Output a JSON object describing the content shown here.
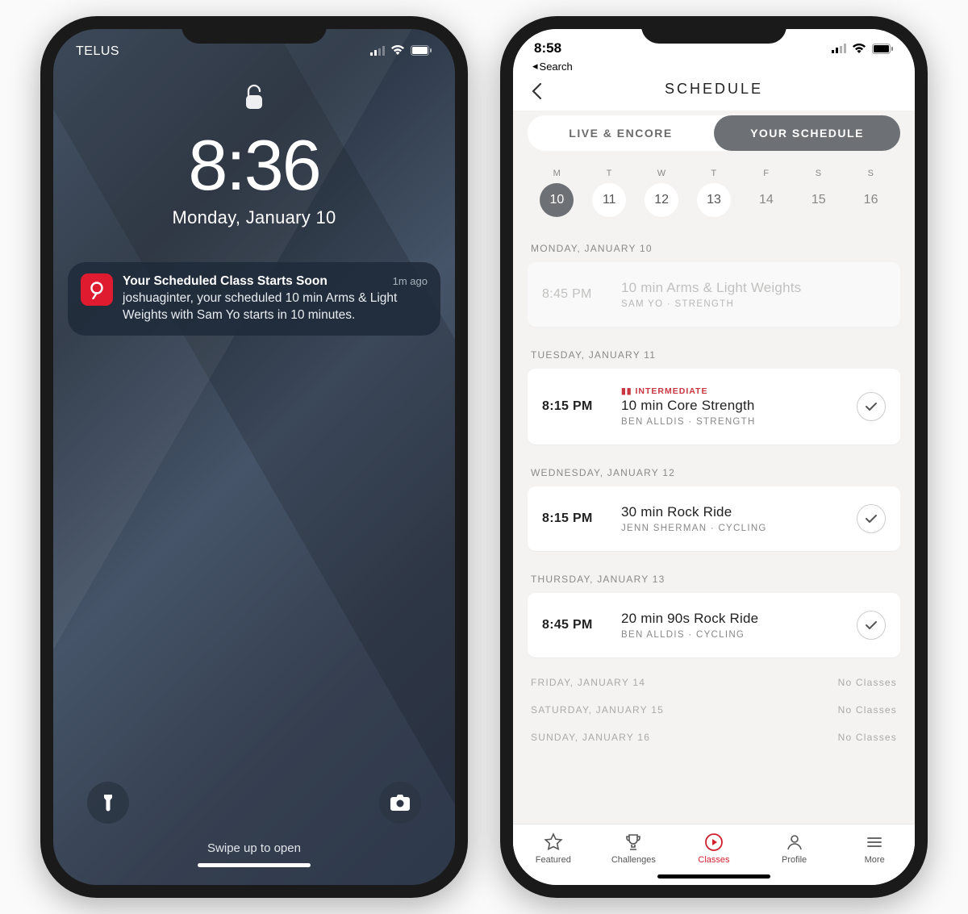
{
  "lockscreen": {
    "carrier": "TELUS",
    "time": "8:36",
    "date": "Monday, January 10",
    "swipe_hint": "Swipe up to open",
    "notification": {
      "app_icon_name": "peloton",
      "title": "Your Scheduled Class Starts Soon",
      "time_ago": "1m ago",
      "body": "joshuaginter, your scheduled 10 min Arms & Light Weights with Sam Yo starts in 10 minutes."
    }
  },
  "schedule": {
    "time": "8:58",
    "back_crumb": "Search",
    "header": "SCHEDULE",
    "seg_live": "LIVE & ENCORE",
    "seg_your": "YOUR SCHEDULE",
    "week": [
      {
        "letter": "M",
        "num": "10",
        "selected": true,
        "has_dot": false
      },
      {
        "letter": "T",
        "num": "11",
        "selected": false,
        "has_dot": true
      },
      {
        "letter": "W",
        "num": "12",
        "selected": false,
        "has_dot": true
      },
      {
        "letter": "T",
        "num": "13",
        "selected": false,
        "has_dot": true
      },
      {
        "letter": "F",
        "num": "14",
        "selected": false,
        "has_dot": false
      },
      {
        "letter": "S",
        "num": "15",
        "selected": false,
        "has_dot": false
      },
      {
        "letter": "S",
        "num": "16",
        "selected": false,
        "has_dot": false
      }
    ],
    "sections": [
      {
        "label": "MONDAY, JANUARY 10",
        "classes": [
          {
            "time": "8:45 PM",
            "level": "",
            "title": "10 min Arms & Light Weights",
            "meta": "SAM YO  ·  STRENGTH",
            "dim": true,
            "check": false
          }
        ]
      },
      {
        "label": "TUESDAY, JANUARY 11",
        "classes": [
          {
            "time": "8:15 PM",
            "level": "INTERMEDIATE",
            "title": "10 min Core Strength",
            "meta": "BEN ALLDIS  ·  STRENGTH",
            "dim": false,
            "check": true
          }
        ]
      },
      {
        "label": "WEDNESDAY, JANUARY 12",
        "classes": [
          {
            "time": "8:15 PM",
            "level": "",
            "title": "30 min Rock Ride",
            "meta": "JENN SHERMAN  ·  CYCLING",
            "dim": false,
            "check": true
          }
        ]
      },
      {
        "label": "THURSDAY, JANUARY 13",
        "classes": [
          {
            "time": "8:45 PM",
            "level": "",
            "title": "20 min 90s Rock Ride",
            "meta": "BEN ALLDIS  ·  CYCLING",
            "dim": false,
            "check": true
          }
        ]
      }
    ],
    "empty_days": [
      {
        "label": "FRIDAY, JANUARY 14",
        "msg": "No Classes"
      },
      {
        "label": "SATURDAY, JANUARY 15",
        "msg": "No Classes"
      },
      {
        "label": "SUNDAY, JANUARY 16",
        "msg": "No Classes"
      }
    ],
    "tabs": {
      "featured": "Featured",
      "challenges": "Challenges",
      "classes": "Classes",
      "profile": "Profile",
      "more": "More"
    }
  }
}
